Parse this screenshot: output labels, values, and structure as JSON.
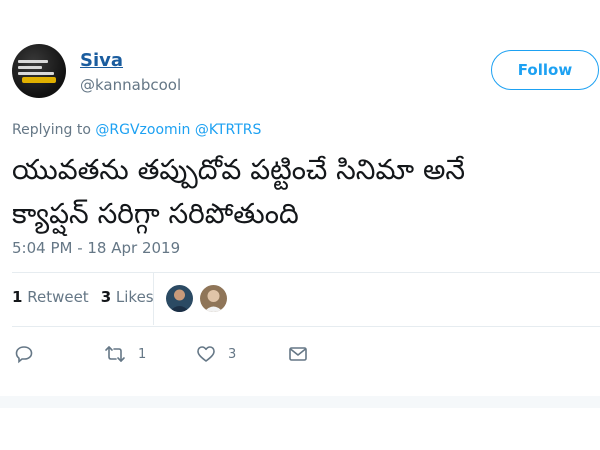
{
  "tweet": {
    "author_name": "Siva",
    "author_handle": "@kannabcool",
    "follow_label": "Follow",
    "replying_prefix": "Replying to",
    "mentions": [
      "@RGVzoomin",
      "@KTRTRS"
    ],
    "text": "యువతను తప్పుదోవ పట్టించే సినిమా అనే\nక్యాప్షన్ సరిగ్గా సరిపోతుంది",
    "timestamp": "5:04 PM - 18 Apr 2019"
  },
  "stats": {
    "retweet_count": "1",
    "retweet_label": "Retweet",
    "like_count": "3",
    "like_label": "Likes"
  },
  "actions": {
    "reply_icon": "reply-icon",
    "retweet_icon": "retweet-icon",
    "retweet_count": "1",
    "like_icon": "heart-icon",
    "like_count": "3",
    "message_icon": "envelope-icon"
  },
  "colors": {
    "link": "#1da1f2",
    "name": "#1a5c9e",
    "muted": "#657786",
    "text": "#14171a",
    "divider": "#e6ecf0"
  }
}
